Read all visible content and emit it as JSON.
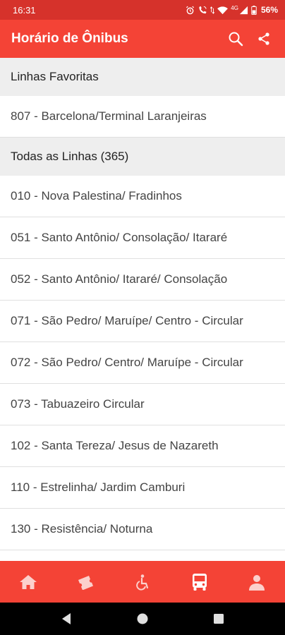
{
  "status_bar": {
    "time": "16:31",
    "network": "4G",
    "battery": "56%",
    "icons": [
      "alarm-icon",
      "wifi-calling-icon",
      "data-arrows-icon",
      "wifi-icon",
      "signal-icon",
      "battery-icon"
    ]
  },
  "app_bar": {
    "title": "Horário de Ônibus",
    "actions": [
      "search-icon",
      "share-icon"
    ]
  },
  "favorites": {
    "header": "Linhas Favoritas",
    "items": [
      "807 - Barcelona/Terminal Laranjeiras"
    ]
  },
  "all_lines": {
    "header": "Todas as Linhas (365)",
    "items": [
      "010 - Nova Palestina/ Fradinhos",
      "051 - Santo Antônio/ Consolação/ Itararé",
      "052 - Santo Antônio/ Itararé/ Consolação",
      "071 - São Pedro/ Maruípe/ Centro - Circular",
      "072 - São Pedro/ Centro/ Maruípe - Circular",
      "073 - Tabuazeiro Circular",
      "102 - Santa Tereza/ Jesus de Nazareth",
      "110 - Estrelinha/ Jardim Camburi",
      "130 - Resistência/ Noturna"
    ]
  },
  "bottom_nav": {
    "items": [
      "home-icon",
      "ticket-icon",
      "accessibility-icon",
      "bus-icon",
      "person-icon"
    ],
    "active": "bus-icon"
  },
  "colors": {
    "primary": "#f44336",
    "status_bar": "#d6322b",
    "section_bg": "#eeeeee"
  }
}
